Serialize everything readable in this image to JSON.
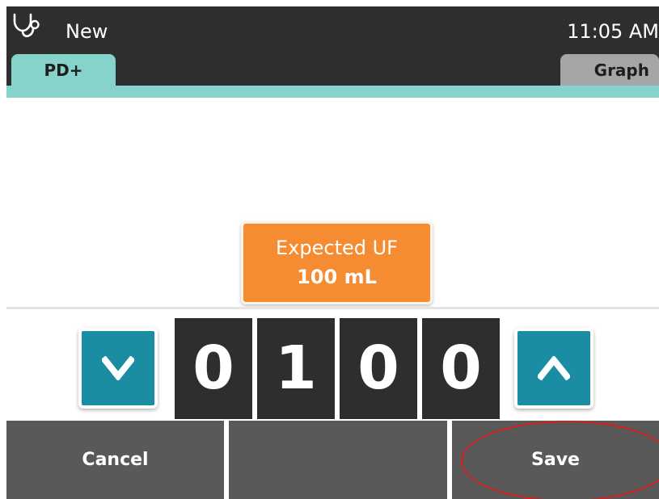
{
  "header": {
    "app_icon": "stethoscope-icon",
    "title": "New",
    "time": "11:05 AM"
  },
  "tabs": [
    {
      "label": "PD+",
      "active": true
    },
    {
      "label": "Graph",
      "active": false
    }
  ],
  "value_display": {
    "label": "Expected UF",
    "value": "100 mL"
  },
  "stepper": {
    "down_icon": "chevron-down-icon",
    "up_icon": "chevron-up-icon",
    "digits": [
      "0",
      "1",
      "0",
      "0"
    ]
  },
  "footer": {
    "cancel_label": "Cancel",
    "middle_label": "",
    "save_label": "Save"
  },
  "colors": {
    "header_bg": "#2e2e2e",
    "tab_active": "#86d3cc",
    "tab_inactive": "#a6a6a6",
    "badge": "#f58c31",
    "step_button": "#1b8da3",
    "digit_bg": "#2e2e2e",
    "footer_button": "#595959",
    "highlight_ring": "#d81e1e"
  }
}
